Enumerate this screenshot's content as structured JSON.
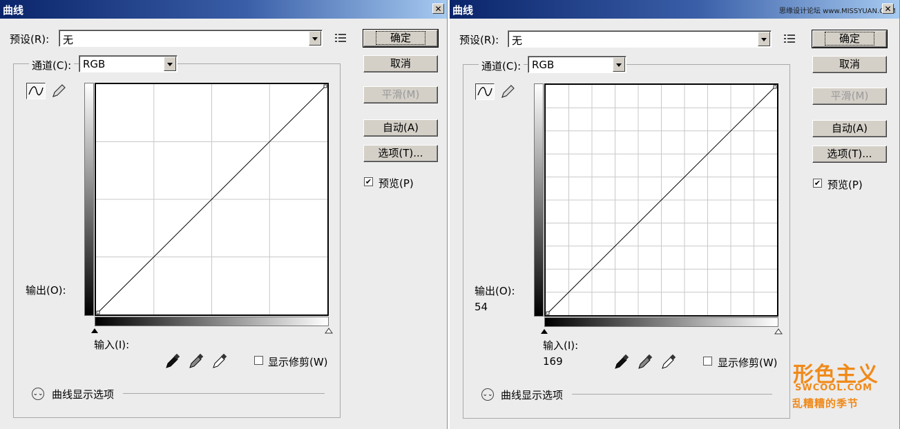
{
  "dialogs": [
    {
      "title": "曲线",
      "preset_label": "预设(R):",
      "preset_value": "无",
      "channel_label": "通道(C):",
      "channel_value": "RGB",
      "output_label": "输出(O):",
      "output_value": "",
      "input_label": "输入(I):",
      "input_value": "",
      "show_clipping_label": "显示修剪(W)",
      "show_clipping_checked": false,
      "curve_options_label": "曲线显示选项",
      "buttons": {
        "ok": "确定",
        "cancel": "取消",
        "smooth": "平滑(M)",
        "auto": "自动(A)",
        "options": "选项(T)..."
      },
      "preview_label": "预览(P)",
      "preview_checked": true,
      "grid_divisions": 4
    },
    {
      "title": "曲线",
      "preset_label": "预设(R):",
      "preset_value": "无",
      "channel_label": "通道(C):",
      "channel_value": "RGB",
      "output_label": "输出(O):",
      "output_value": "54",
      "input_label": "输入(I):",
      "input_value": "169",
      "show_clipping_label": "显示修剪(W)",
      "show_clipping_checked": false,
      "curve_options_label": "曲线显示选项",
      "buttons": {
        "ok": "确定",
        "cancel": "取消",
        "smooth": "平滑(M)",
        "auto": "自动(A)",
        "options": "选项(T)..."
      },
      "preview_label": "预览(P)",
      "preview_checked": true,
      "grid_divisions": 10
    }
  ],
  "watermark": {
    "top_text": "思缘设计论坛 www.MISSYUAN.COM",
    "brand": "形色主义",
    "site": "SWCOOL.COM",
    "slogan": "乱糟糟的季节",
    "color": "#f08a1a"
  },
  "icons": {
    "close": "close-icon",
    "menu": "menu-list-icon",
    "curve_tool": "curve-point-icon",
    "pencil_tool": "pencil-icon",
    "eyedropper_black": "eyedropper-black-icon",
    "eyedropper_gray": "eyedropper-gray-icon",
    "eyedropper_white": "eyedropper-white-icon",
    "expand": "double-chevron-down-icon"
  }
}
